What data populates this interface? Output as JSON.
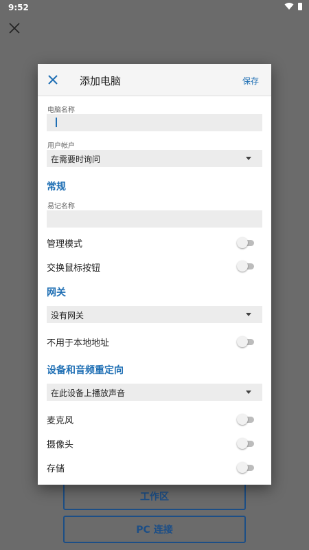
{
  "status_bar": {
    "time": "9:52"
  },
  "background": {
    "workspace_button": "工作区",
    "pc_connect_button": "PC 连接"
  },
  "dialog": {
    "title": "添加电脑",
    "save_label": "保存",
    "pc_name": {
      "label": "电脑名称",
      "value": ""
    },
    "user_account": {
      "label": "用户帐户",
      "selected": "在需要时询问"
    },
    "general": {
      "header": "常规",
      "friendly_name": {
        "label": "易记名称",
        "value": ""
      },
      "admin_mode": {
        "label": "管理模式",
        "on": false
      },
      "swap_mouse": {
        "label": "交换鼠标按钮",
        "on": false
      }
    },
    "gateway": {
      "header": "网关",
      "selected": "没有网关",
      "bypass_local": {
        "label": "不用于本地地址",
        "on": false
      }
    },
    "redirection": {
      "header": "设备和音频重定向",
      "audio_selected": "在此设备上播放声音",
      "microphone": {
        "label": "麦克风",
        "on": false
      },
      "camera": {
        "label": "摄像头",
        "on": false
      },
      "storage": {
        "label": "存储",
        "on": false
      }
    }
  }
}
